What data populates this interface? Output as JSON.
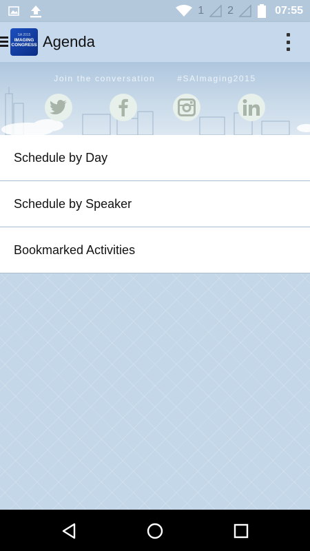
{
  "status_bar": {
    "sim1": "1",
    "sim2": "2",
    "time": "07:55"
  },
  "app_bar": {
    "title": "Agenda",
    "logo": {
      "year": "SA 2015",
      "line1": "IMAGING",
      "line2": "CONGRESS"
    }
  },
  "banner": {
    "caption": "Join the conversation",
    "hashtag": "#SAImaging2015",
    "social": [
      "twitter-icon",
      "facebook-icon",
      "instagram-icon",
      "linkedin-icon"
    ]
  },
  "menu": {
    "items": [
      {
        "label": "Schedule by Day"
      },
      {
        "label": "Schedule by Speaker"
      },
      {
        "label": "Bookmarked Activities"
      }
    ]
  },
  "colors": {
    "status_bar": "#b4c8dc",
    "app_bar": "#c5d8ec",
    "background": "#c4d7e8",
    "nav_bar": "#000000"
  }
}
